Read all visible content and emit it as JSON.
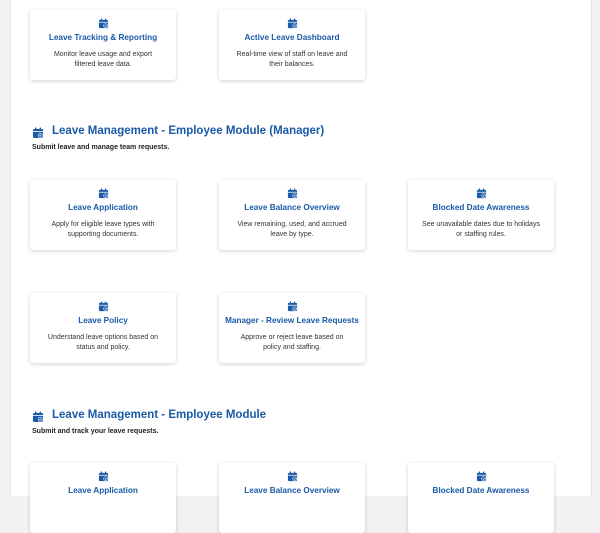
{
  "top_cards": [
    {
      "title": "Leave Tracking & Reporting",
      "desc": "Monitor leave usage and export filtered leave data."
    },
    {
      "title": "Active Leave Dashboard",
      "desc": "Real-time view of staff on leave and their balances."
    }
  ],
  "sections": [
    {
      "title": "Leave Management - Employee Module (Manager)",
      "subtitle": "Submit leave and manage team requests.",
      "icon": "calendar-check-icon",
      "cards": [
        {
          "title": "Leave Application",
          "desc": "Apply for eligible leave types with supporting documents."
        },
        {
          "title": "Leave Balance Overview",
          "desc": "View remaining, used, and accrued leave by type."
        },
        {
          "title": "Blocked Date Awareness",
          "desc": "See unavailable dates due to holidays or staffing rules."
        },
        {
          "title": "Leave Policy",
          "desc": "Understand leave options based on status and policy."
        },
        {
          "title": "Manager - Review Leave Requests",
          "desc": "Approve or reject leave based on policy and staffing."
        }
      ]
    },
    {
      "title": "Leave Management - Employee Module",
      "subtitle": "Submit and track your leave requests.",
      "icon": "calendar-check-icon",
      "cards": [
        {
          "title": "Leave Application"
        },
        {
          "title": "Leave Balance Overview"
        },
        {
          "title": "Blocked Date Awareness"
        }
      ]
    }
  ],
  "colors": {
    "accent": "#1a5aa8",
    "background": "#f2f2f2",
    "card": "#ffffff"
  }
}
